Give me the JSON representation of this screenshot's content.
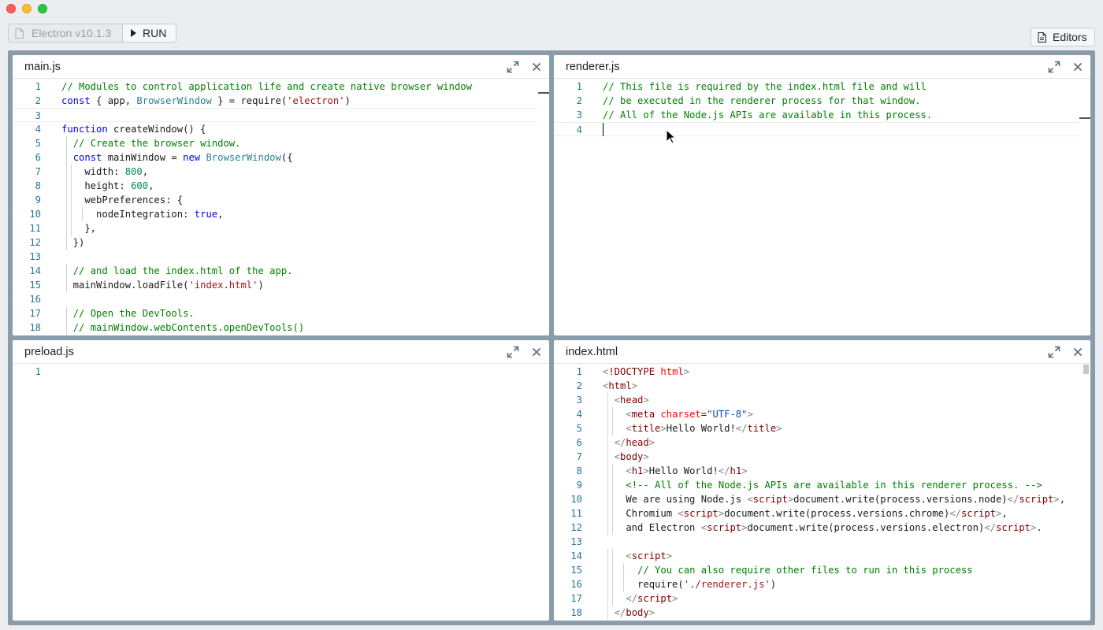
{
  "toolbar": {
    "version_label": "Electron v10.1.3",
    "run_label": "RUN",
    "editors_label": "Editors"
  },
  "panes": {
    "main": {
      "title": "main.js",
      "lines": [
        {
          "n": "1",
          "parts": [
            [
              "c-com",
              "// Modules to control application life and create native browser window"
            ]
          ]
        },
        {
          "n": "2",
          "parts": [
            [
              "c-kw",
              "const"
            ],
            [
              "",
              " { app, "
            ],
            [
              "c-cls",
              "BrowserWindow"
            ],
            [
              "",
              " } = require("
            ],
            [
              "c-str",
              "'electron'"
            ],
            [
              "",
              ")"
            ]
          ]
        },
        {
          "n": "3",
          "parts": [
            [
              "",
              ""
            ]
          ]
        },
        {
          "n": "4",
          "parts": [
            [
              "c-kw",
              "function"
            ],
            [
              "",
              " createWindow() {"
            ]
          ]
        },
        {
          "n": "5",
          "parts": [
            [
              "",
              "  "
            ],
            [
              "c-com",
              "// Create the browser window."
            ]
          ]
        },
        {
          "n": "6",
          "parts": [
            [
              "",
              "  "
            ],
            [
              "c-kw",
              "const"
            ],
            [
              "",
              " mainWindow = "
            ],
            [
              "c-kw",
              "new"
            ],
            [
              "",
              " "
            ],
            [
              "c-cls",
              "BrowserWindow"
            ],
            [
              "",
              "({"
            ]
          ]
        },
        {
          "n": "7",
          "parts": [
            [
              "",
              "    width: "
            ],
            [
              "c-num",
              "800"
            ],
            [
              "",
              ","
            ]
          ]
        },
        {
          "n": "8",
          "parts": [
            [
              "",
              "    height: "
            ],
            [
              "c-num",
              "600"
            ],
            [
              "",
              ","
            ]
          ]
        },
        {
          "n": "9",
          "parts": [
            [
              "",
              "    webPreferences: {"
            ]
          ]
        },
        {
          "n": "10",
          "parts": [
            [
              "",
              "      nodeIntegration: "
            ],
            [
              "c-kw",
              "true"
            ],
            [
              "",
              ","
            ]
          ]
        },
        {
          "n": "11",
          "parts": [
            [
              "",
              "    },"
            ]
          ]
        },
        {
          "n": "12",
          "parts": [
            [
              "",
              "  })"
            ]
          ]
        },
        {
          "n": "13",
          "parts": [
            [
              "",
              ""
            ]
          ]
        },
        {
          "n": "14",
          "parts": [
            [
              "",
              "  "
            ],
            [
              "c-com",
              "// and load the index.html of the app."
            ]
          ]
        },
        {
          "n": "15",
          "parts": [
            [
              "",
              "  mainWindow.loadFile("
            ],
            [
              "c-str",
              "'index.html'"
            ],
            [
              "",
              ")"
            ]
          ]
        },
        {
          "n": "16",
          "parts": [
            [
              "",
              ""
            ]
          ]
        },
        {
          "n": "17",
          "parts": [
            [
              "",
              "  "
            ],
            [
              "c-com",
              "// Open the DevTools."
            ]
          ]
        },
        {
          "n": "18",
          "parts": [
            [
              "",
              "  "
            ],
            [
              "c-com",
              "// mainWindow.webContents.openDevTools()"
            ]
          ]
        }
      ]
    },
    "renderer": {
      "title": "renderer.js",
      "lines": [
        {
          "n": "1",
          "parts": [
            [
              "c-com",
              "// This file is required by the index.html file and will"
            ]
          ]
        },
        {
          "n": "2",
          "parts": [
            [
              "c-com",
              "// be executed in the renderer process for that window."
            ]
          ]
        },
        {
          "n": "3",
          "parts": [
            [
              "c-com",
              "// All of the Node.js APIs are available in this process."
            ]
          ]
        },
        {
          "n": "4",
          "parts": [
            [
              "",
              ""
            ]
          ]
        }
      ]
    },
    "preload": {
      "title": "preload.js",
      "lines": [
        {
          "n": "1",
          "parts": [
            [
              "",
              ""
            ]
          ]
        }
      ]
    },
    "index": {
      "title": "index.html",
      "lines": [
        {
          "n": "1",
          "parts": [
            [
              "c-pun",
              "<"
            ],
            [
              "c-dt",
              "!DOCTYPE"
            ],
            [
              "",
              " "
            ],
            [
              "c-attr",
              "html"
            ],
            [
              "c-pun",
              ">"
            ]
          ]
        },
        {
          "n": "2",
          "parts": [
            [
              "c-pun",
              "<"
            ],
            [
              "c-tag",
              "html"
            ],
            [
              "c-pun",
              ">"
            ]
          ]
        },
        {
          "n": "3",
          "parts": [
            [
              "",
              "  "
            ],
            [
              "c-pun",
              "<"
            ],
            [
              "c-tag",
              "head"
            ],
            [
              "c-pun",
              ">"
            ]
          ]
        },
        {
          "n": "4",
          "parts": [
            [
              "",
              "    "
            ],
            [
              "c-pun",
              "<"
            ],
            [
              "c-tag",
              "meta"
            ],
            [
              "",
              " "
            ],
            [
              "c-attr",
              "charset"
            ],
            [
              "",
              "="
            ],
            [
              "c-val",
              "\"UTF-8\""
            ],
            [
              "c-pun",
              ">"
            ]
          ]
        },
        {
          "n": "5",
          "parts": [
            [
              "",
              "    "
            ],
            [
              "c-pun",
              "<"
            ],
            [
              "c-tag",
              "title"
            ],
            [
              "c-pun",
              ">"
            ],
            [
              "",
              "Hello World!"
            ],
            [
              "c-pun",
              "</"
            ],
            [
              "c-tag",
              "title"
            ],
            [
              "c-pun",
              ">"
            ]
          ]
        },
        {
          "n": "6",
          "parts": [
            [
              "",
              "  "
            ],
            [
              "c-pun",
              "</"
            ],
            [
              "c-tag",
              "head"
            ],
            [
              "c-pun",
              ">"
            ]
          ]
        },
        {
          "n": "7",
          "parts": [
            [
              "",
              "  "
            ],
            [
              "c-pun",
              "<"
            ],
            [
              "c-tag",
              "body"
            ],
            [
              "c-pun",
              ">"
            ]
          ]
        },
        {
          "n": "8",
          "parts": [
            [
              "",
              "    "
            ],
            [
              "c-pun",
              "<"
            ],
            [
              "c-tag",
              "h1"
            ],
            [
              "c-pun",
              ">"
            ],
            [
              "",
              "Hello World!"
            ],
            [
              "c-pun",
              "</"
            ],
            [
              "c-tag",
              "h1"
            ],
            [
              "c-pun",
              ">"
            ]
          ]
        },
        {
          "n": "9",
          "parts": [
            [
              "",
              "    "
            ],
            [
              "c-com",
              "<!-- All of the Node.js APIs are available in this renderer process. -->"
            ]
          ]
        },
        {
          "n": "10",
          "parts": [
            [
              "",
              "    We are using Node.js "
            ],
            [
              "c-pun",
              "<"
            ],
            [
              "c-tag",
              "script"
            ],
            [
              "c-pun",
              ">"
            ],
            [
              "",
              "document.write(process.versions.node)"
            ],
            [
              "c-pun",
              "</"
            ],
            [
              "c-tag",
              "script"
            ],
            [
              "c-pun",
              ">"
            ],
            [
              "",
              ","
            ]
          ]
        },
        {
          "n": "11",
          "parts": [
            [
              "",
              "    Chromium "
            ],
            [
              "c-pun",
              "<"
            ],
            [
              "c-tag",
              "script"
            ],
            [
              "c-pun",
              ">"
            ],
            [
              "",
              "document.write(process.versions.chrome)"
            ],
            [
              "c-pun",
              "</"
            ],
            [
              "c-tag",
              "script"
            ],
            [
              "c-pun",
              ">"
            ],
            [
              "",
              ","
            ]
          ]
        },
        {
          "n": "12",
          "parts": [
            [
              "",
              "    and Electron "
            ],
            [
              "c-pun",
              "<"
            ],
            [
              "c-tag",
              "script"
            ],
            [
              "c-pun",
              ">"
            ],
            [
              "",
              "document.write(process.versions.electron)"
            ],
            [
              "c-pun",
              "</"
            ],
            [
              "c-tag",
              "script"
            ],
            [
              "c-pun",
              ">"
            ],
            [
              "",
              "."
            ]
          ]
        },
        {
          "n": "13",
          "parts": [
            [
              "",
              ""
            ]
          ]
        },
        {
          "n": "14",
          "parts": [
            [
              "",
              "    "
            ],
            [
              "c-pun",
              "<"
            ],
            [
              "c-tag",
              "script"
            ],
            [
              "c-pun",
              ">"
            ]
          ]
        },
        {
          "n": "15",
          "parts": [
            [
              "",
              "      "
            ],
            [
              "c-com",
              "// You can also require other files to run in this process"
            ]
          ]
        },
        {
          "n": "16",
          "parts": [
            [
              "",
              "      require("
            ],
            [
              "c-str",
              "'./renderer.js'"
            ],
            [
              "",
              ")"
            ]
          ]
        },
        {
          "n": "17",
          "parts": [
            [
              "",
              "    "
            ],
            [
              "c-pun",
              "</"
            ],
            [
              "c-tag",
              "script"
            ],
            [
              "c-pun",
              ">"
            ]
          ]
        },
        {
          "n": "18",
          "parts": [
            [
              "",
              "  "
            ],
            [
              "c-pun",
              "</"
            ],
            [
              "c-tag",
              "body"
            ],
            [
              "c-pun",
              ">"
            ]
          ]
        }
      ]
    }
  },
  "colors": {
    "workspace_bg": "#8a9baa",
    "line_number": "#237893",
    "comment": "#008000",
    "keyword": "#0000ff"
  }
}
